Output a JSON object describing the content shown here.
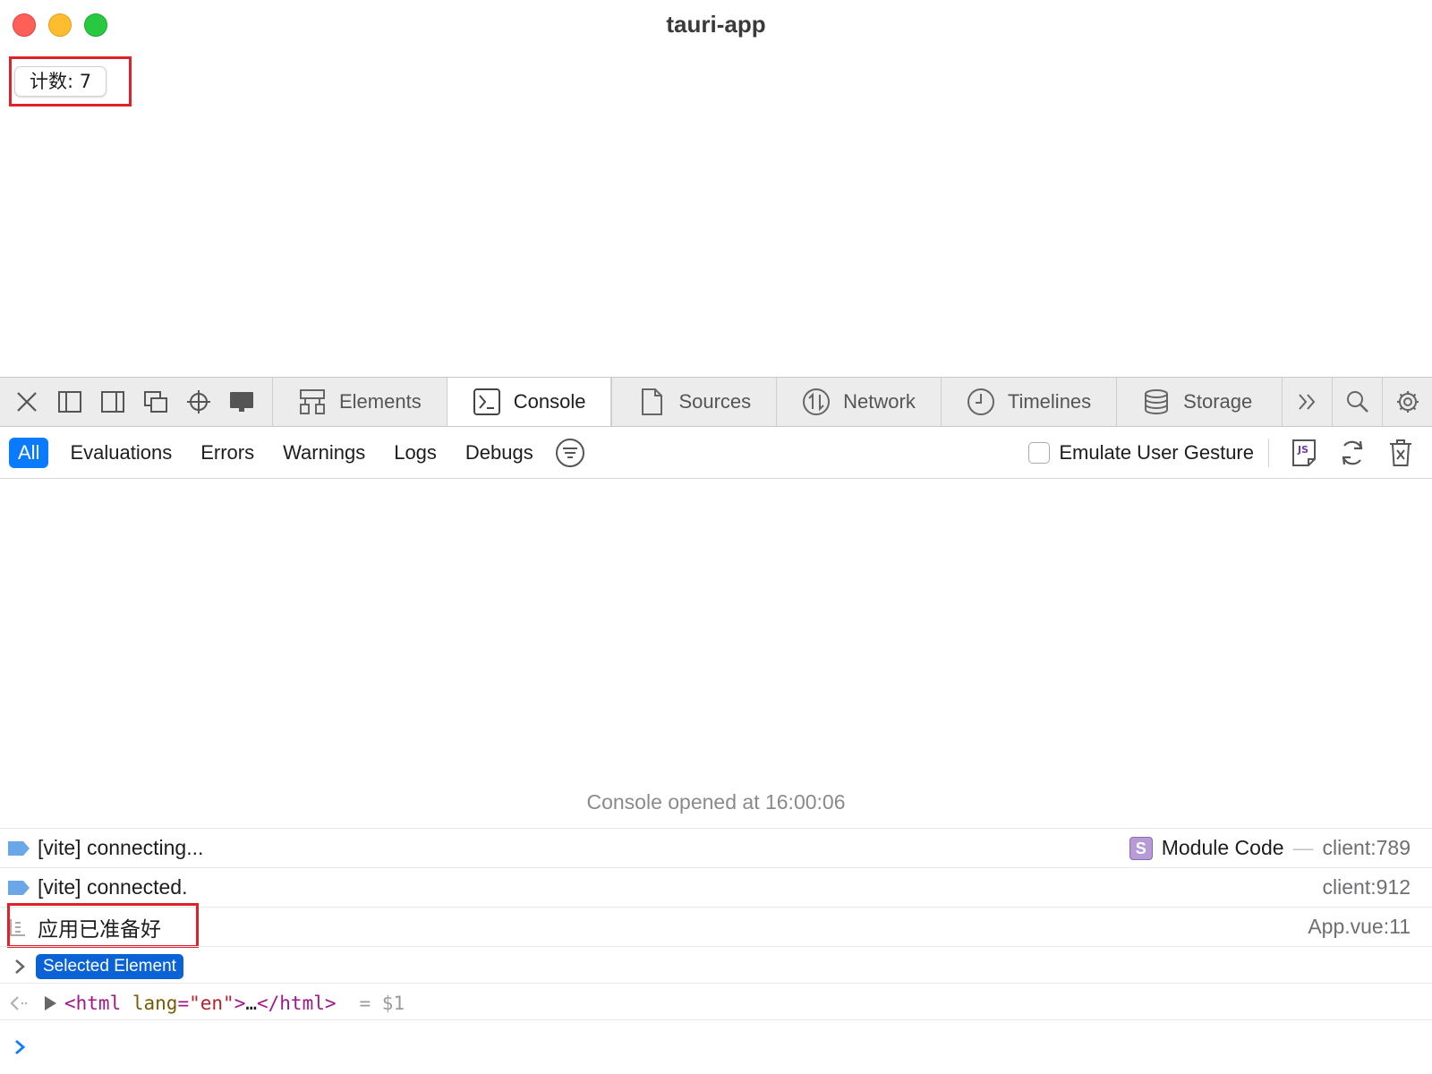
{
  "window": {
    "title": "tauri-app"
  },
  "app": {
    "counter_label": "计数: 7"
  },
  "devtools": {
    "tabs": [
      {
        "label": "Elements"
      },
      {
        "label": "Console"
      },
      {
        "label": "Sources"
      },
      {
        "label": "Network"
      },
      {
        "label": "Timelines"
      },
      {
        "label": "Storage"
      }
    ],
    "active_tab": "Console"
  },
  "filters": {
    "items": [
      {
        "label": "All"
      },
      {
        "label": "Evaluations"
      },
      {
        "label": "Errors"
      },
      {
        "label": "Warnings"
      },
      {
        "label": "Logs"
      },
      {
        "label": "Debugs"
      }
    ],
    "active": "All",
    "emulate_label": "Emulate User Gesture"
  },
  "console": {
    "opened_text": "Console opened at 16:00:06",
    "messages": [
      {
        "text": "[vite] connecting...",
        "source_module": "Module Code",
        "source_dash": "—",
        "source_loc": "client:789"
      },
      {
        "text": "[vite] connected.",
        "source_loc": "client:912"
      },
      {
        "text": "应用已准备好",
        "source_loc": "App.vue:11"
      }
    ],
    "selected_badge": "Selected Element",
    "result": {
      "open_tag": "<html",
      "attr_name": "lang",
      "attr_eq": "=",
      "attr_value": "\"en\"",
      "tag_close": ">",
      "ellipsis": "…",
      "end_tag": "</html>",
      "assign": "= $1"
    },
    "badge_letter": "S"
  },
  "colors": {
    "accent": "#0a7aff",
    "highlight": "#e0202a",
    "tag": "#a3168a"
  }
}
